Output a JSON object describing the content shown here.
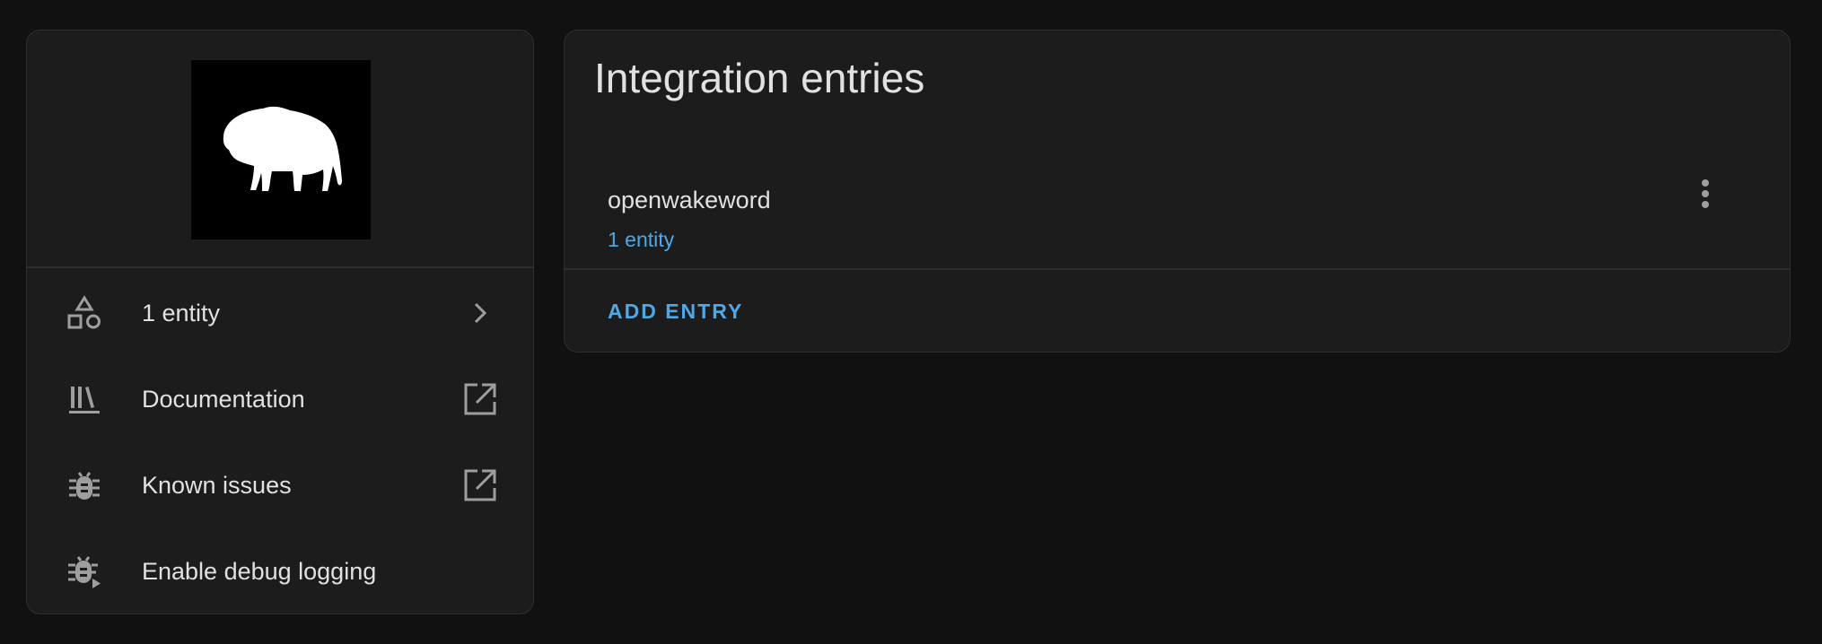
{
  "sidebar": {
    "logo_icon": "bison-logo",
    "items": [
      {
        "label": "1 entity",
        "icon": "shapes-icon",
        "trail_icon": "chevron-right-icon"
      },
      {
        "label": "Documentation",
        "icon": "library-books-icon",
        "trail_icon": "open-in-new-icon"
      },
      {
        "label": "Known issues",
        "icon": "bug-icon",
        "trail_icon": "open-in-new-icon"
      },
      {
        "label": "Enable debug logging",
        "icon": "bug-play-icon",
        "trail_icon": ""
      }
    ]
  },
  "main": {
    "title": "Integration entries",
    "entries": [
      {
        "name": "openwakeword",
        "entities_link": "1 entity"
      }
    ],
    "add_entry_label": "ADD ENTRY"
  },
  "colors": {
    "background": "#111111",
    "card": "#1c1c1c",
    "accent": "#4ea8e8",
    "text": "#e1e1e1",
    "icon": "#9e9e9e"
  }
}
